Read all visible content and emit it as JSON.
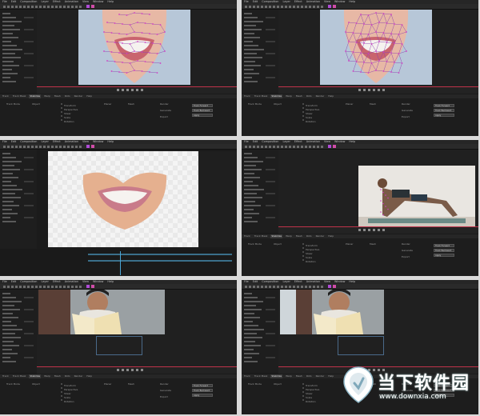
{
  "menu_items": [
    "File",
    "Edit",
    "Composition",
    "Layer",
    "Effect",
    "Animation",
    "View",
    "Window",
    "Help"
  ],
  "bottom_tabs": [
    "Track",
    "Track Mask",
    "Stabilize",
    "Warp",
    "Mesh",
    "Roto",
    "Render",
    "Help"
  ],
  "labels": {
    "track_mode": "Track Mode",
    "object": "Object",
    "transform": "Transform",
    "perspective": "Perspective",
    "shear": "Shear",
    "scale": "Scale",
    "rotation": "Rotation",
    "track_forward": "Track Forward",
    "track_backward": "Track Backward",
    "planar": "Planar",
    "render": "Render",
    "mesh": "Mesh",
    "apply": "Apply",
    "generate": "Generate",
    "export": "Export"
  },
  "watermark": {
    "title": "当下软件园",
    "url": "www.downxia.com"
  },
  "colors": {
    "ui_dark": "#1b1b1b",
    "accent_purple": "#b04cd6",
    "timeline_red": "#c0324a",
    "mesh_purple": "#8b3fb0"
  },
  "icons": [
    "play-icon",
    "rewind-icon",
    "forward-icon",
    "step-icon",
    "stop-icon",
    "watermark-logo-icon"
  ]
}
